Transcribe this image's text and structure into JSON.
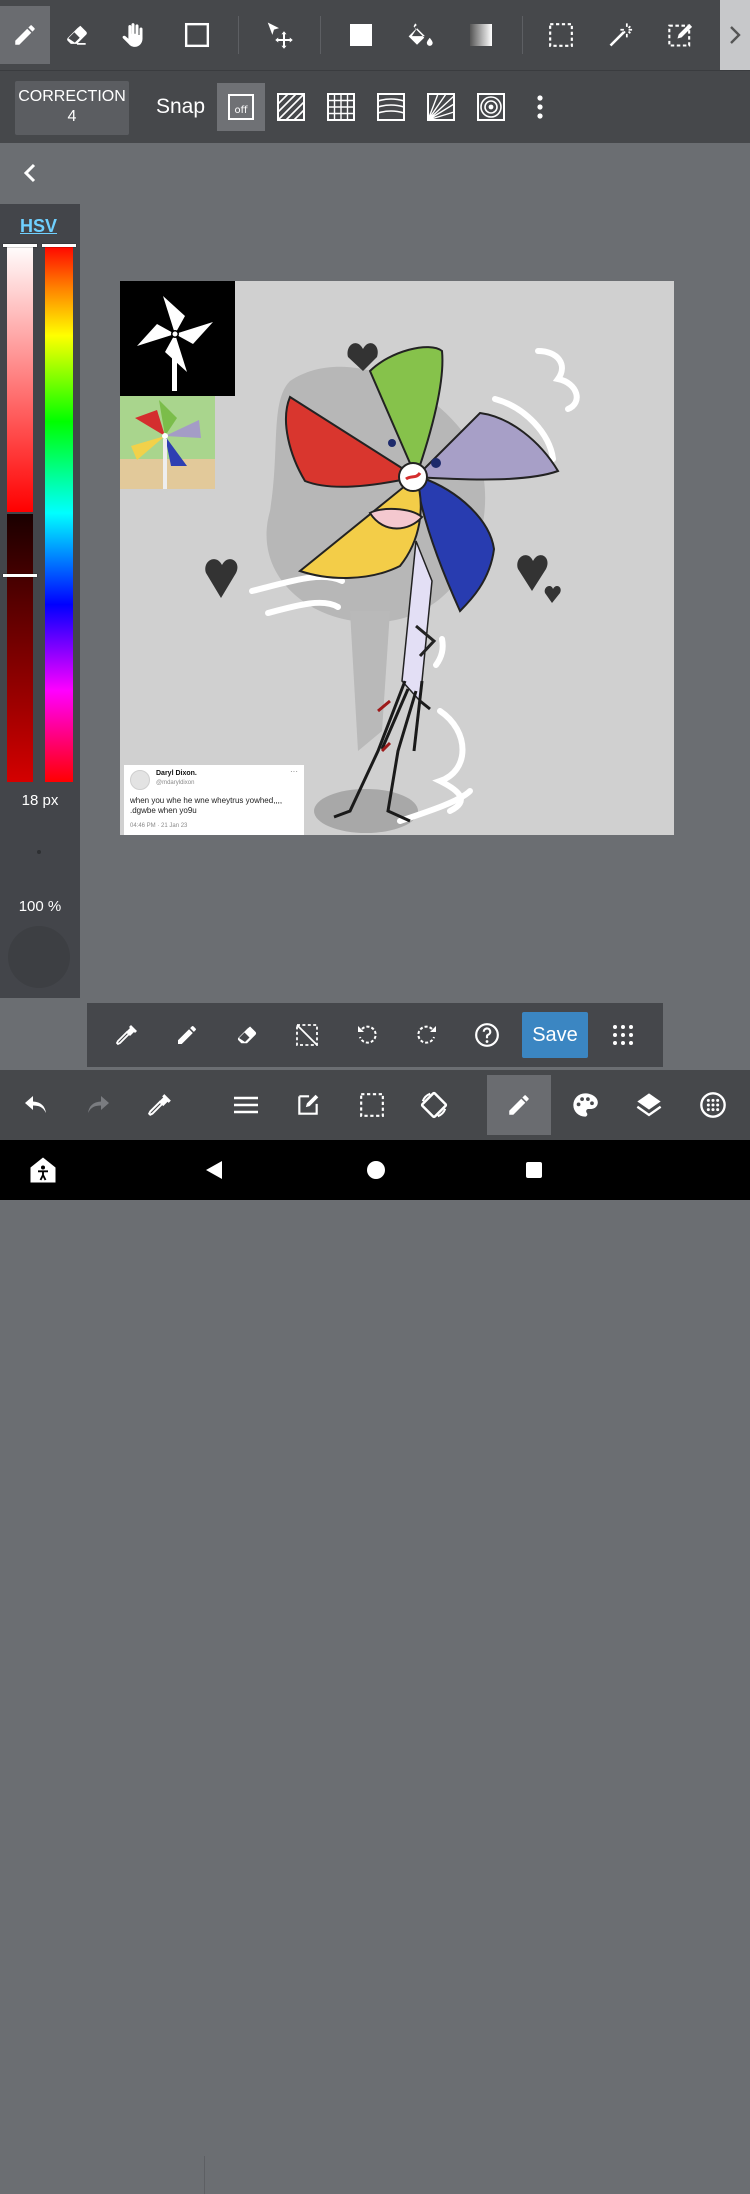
{
  "top_toolbar": {
    "tools": [
      {
        "name": "pen-tool",
        "selected": true
      },
      {
        "name": "eraser-tool",
        "selected": false
      },
      {
        "name": "hand-tool",
        "selected": false
      },
      {
        "name": "shape-tool",
        "selected": false
      },
      {
        "name": "move-tool",
        "selected": false
      },
      {
        "name": "fill-rect-tool",
        "selected": false
      },
      {
        "name": "bucket-tool",
        "selected": false
      },
      {
        "name": "gradient-tool",
        "selected": false
      },
      {
        "name": "select-tool",
        "selected": false
      },
      {
        "name": "magic-wand-tool",
        "selected": false
      },
      {
        "name": "select-pen-tool",
        "selected": false
      }
    ]
  },
  "sub_toolbar": {
    "correction_label": "CORRECTION 4",
    "snap_label": "Snap",
    "snap_off_label": "off"
  },
  "color_panel": {
    "mode_label": "HSV",
    "current_color": "#ff0000",
    "saturation": 1.0,
    "value": 0.78,
    "hue": 0,
    "brush_size": "18 px",
    "opacity": "100 %"
  },
  "canvas": {
    "tweet": {
      "name": "Daryl Dixon.",
      "handle": "@mdaryldixon",
      "text": "when you whe he wne wheytrus yowhed,,,, .dgwbe when yo9u",
      "time": "04:46 PM · 21 Jan 23",
      "menu": "···"
    }
  },
  "bottom_bar": {
    "save_label": "Save"
  },
  "colors": {
    "toolbar": "#46484b",
    "workspace": "#6b6e72",
    "accent": "#3b86c2",
    "hsv_tab": "#6fd0ff"
  }
}
